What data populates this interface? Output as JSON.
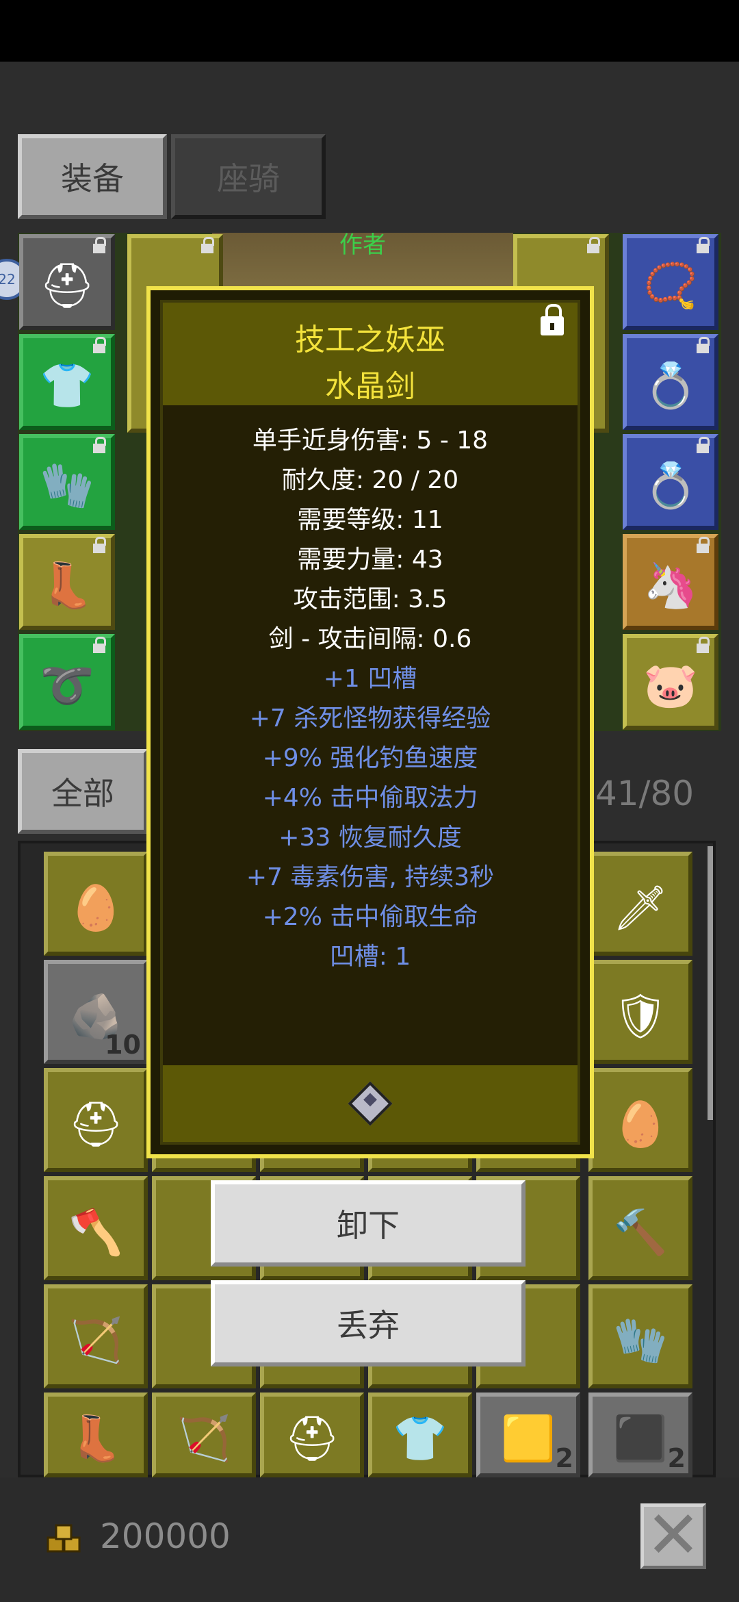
{
  "tabs": {
    "equipment": "装备",
    "mount": "座骑"
  },
  "character": {
    "name_partial": "作者",
    "level_badge": "22"
  },
  "equipment_slots": {
    "left": [
      "helmet-icon",
      "chest-armor-icon",
      "gloves-icon",
      "boots-icon",
      "belt-icon"
    ],
    "right": [
      "amulet-icon",
      "ring-icon",
      "ring-icon",
      "pet-icon",
      "pet-icon"
    ]
  },
  "inventory": {
    "filter_tab": "全部",
    "capacity": "41/80",
    "counts": {
      "ore": "10",
      "gold_nugget": "2",
      "coal": "2"
    }
  },
  "tooltip": {
    "prefix_name": "技工之妖巫",
    "item_name": "水晶剑",
    "base_stats": [
      "单手近身伤害: 5 - 18",
      "耐久度: 20 / 20",
      "需要等级: 11",
      "需要力量: 43",
      "攻击范围: 3.5",
      "剑 - 攻击间隔: 0.6"
    ],
    "magic_stats": [
      "+1 凹槽",
      "+7 杀死怪物获得经验",
      "+9% 强化钓鱼速度",
      "+4% 击中偷取法力",
      "+33 恢复耐久度",
      "+7 毒素伤害, 持续3秒",
      "+2% 击中偷取生命",
      "凹槽: 1"
    ],
    "lock_icon": "lock-icon",
    "socket_icon": "gem-socket-icon"
  },
  "actions": {
    "unequip": "卸下",
    "discard": "丢弃"
  },
  "footer": {
    "gold": "200000",
    "close_icon": "close-icon"
  },
  "colors": {
    "tooltip_border": "#f1e34a",
    "title": "#f4e33c",
    "magic_stat": "#6f8fe6"
  }
}
